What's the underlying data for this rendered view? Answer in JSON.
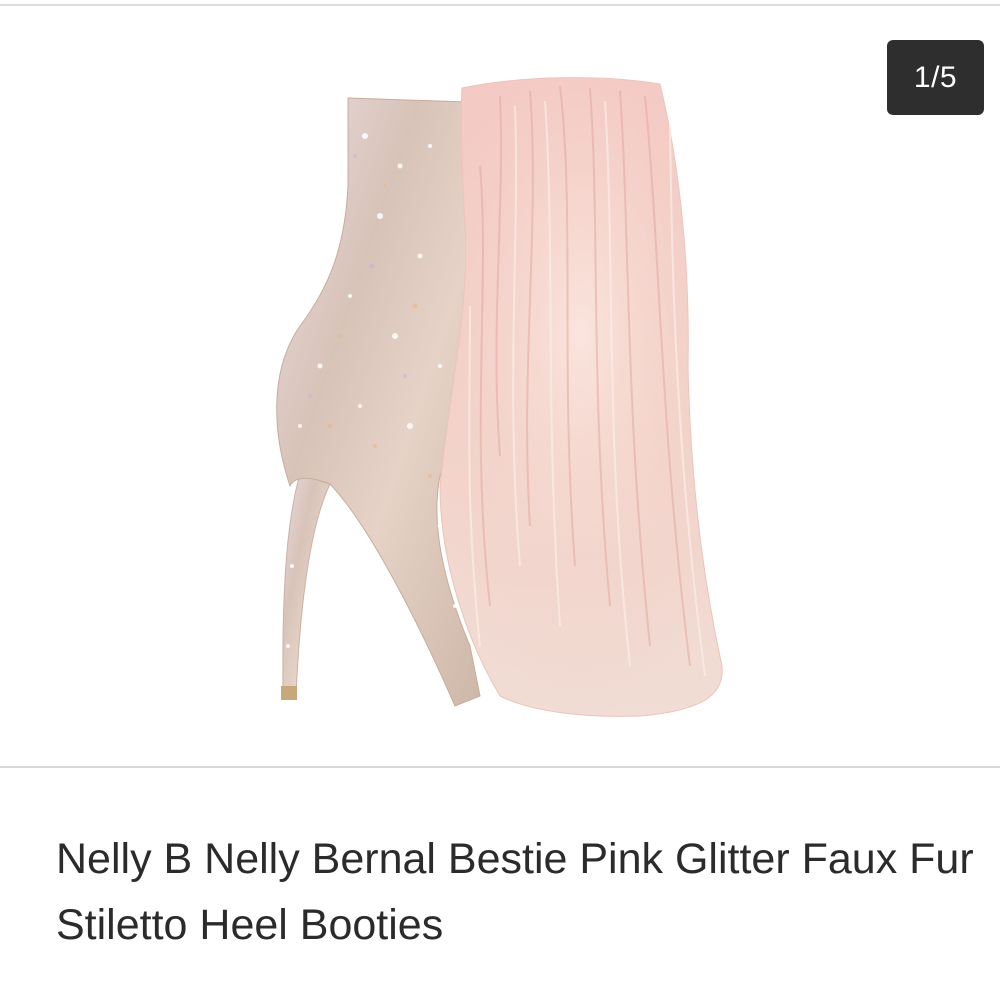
{
  "gallery": {
    "counter": "1/5",
    "image_description_icon": "product-photo-glitter-fur-boot"
  },
  "product": {
    "title": "Nelly B Nelly Bernal Bestie Pink Glitter Faux Fur Stiletto Heel Booties"
  },
  "colors": {
    "background": "#ffffff",
    "counter_badge": "#2e2e2e",
    "title_text": "#2b2b2b",
    "divider": "#d8d8d8"
  }
}
